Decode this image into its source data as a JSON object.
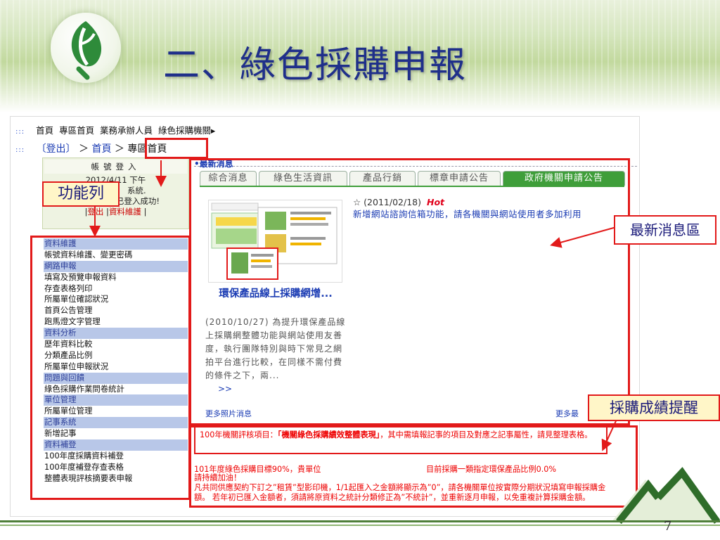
{
  "slide": {
    "title": "二、綠色採購申報",
    "page_number": "7"
  },
  "nav": {
    "primary": [
      "首頁",
      "專區首頁",
      "業務承辦人員",
      "綠色採購機關▸"
    ],
    "logout": "〔登出〕",
    "crumb_sep": "＞",
    "crumb_home": "首頁",
    "crumb_current": "專區首頁"
  },
  "login_box": {
    "header": "帳號登入",
    "date_fragment": "2012/4/11 下午",
    "system_fragment": "系統.",
    "success_fragment": "3:53  0  ...您已登入成功!",
    "logout_link": "登出",
    "account_link": "資料維護"
  },
  "menu": [
    {
      "type": "cat",
      "label": "資料維護"
    },
    {
      "type": "item",
      "label": "帳號資料維護、變更密碼"
    },
    {
      "type": "cat",
      "label": "網路申報"
    },
    {
      "type": "item",
      "label": "填寫及預覽申報資料"
    },
    {
      "type": "item",
      "label": "存查表格列印"
    },
    {
      "type": "item",
      "label": "所屬單位確認狀況"
    },
    {
      "type": "item",
      "label": "首頁公告管理"
    },
    {
      "type": "item",
      "label": "跑馬燈文字管理"
    },
    {
      "type": "cat",
      "label": "資料分析"
    },
    {
      "type": "item",
      "label": "歷年資料比較"
    },
    {
      "type": "item",
      "label": "分類產品比例"
    },
    {
      "type": "item",
      "label": "所屬單位申報狀況"
    },
    {
      "type": "cat",
      "label": "問題與回饋"
    },
    {
      "type": "item",
      "label": "綠色採購作業問卷統計"
    },
    {
      "type": "cat",
      "label": "單位管理"
    },
    {
      "type": "item",
      "label": "所屬單位管理"
    },
    {
      "type": "cat",
      "label": "記事系統"
    },
    {
      "type": "item",
      "label": "新增記事"
    },
    {
      "type": "cat",
      "label": "資料補登"
    },
    {
      "type": "item",
      "label": "100年度採購資料補登"
    },
    {
      "type": "item",
      "label": "100年度補登存查表格"
    },
    {
      "type": "item",
      "label": "整體表現評核摘要表申報"
    }
  ],
  "news": {
    "section_title": "•最新消息",
    "tabs": [
      "綜合消息",
      "綠色生活資訊",
      "產品行銷",
      "標章申請公告",
      "政府機關申請公告"
    ],
    "active_tab": 4,
    "photo_title": "環保產品線上採購網增...",
    "photo_desc": "(2010/10/27) 為提升環保產品線上採購網整體功能與網站使用友善度，執行團隊特別與時下常見之網拍平台進行比較，在同樣不需付費的條件之下，兩...",
    "photo_more": ">>",
    "more_photos": "更多照片消息",
    "more_news": "更多最",
    "item_date": "☆ (2011/02/18)",
    "item_hot": "Hot",
    "item_text": "新增網站諮詢信箱功能，請各機關與網站使用者多加利用"
  },
  "evaluation": {
    "text_a": "100年機關評核項目：",
    "text_b": "「機關綠色採購績效整體表現」",
    "text_c": "，其中需填報記事的項目及對應之記事屬性，請見整理表格。"
  },
  "goal": {
    "left": "101年度綠色採購目標90%，貴單位",
    "right": "目前採購一類指定環保產品比例0.0%",
    "line2": "請持續加油！",
    "line3": "凡共同供應契約下訂之”租賃”型影印機，1/1起匯入之金額將顯示為”0”，請各機關單位按實際分期狀況填寫申報採購金額。 若年初已匯入金額者，須請將原資料之統計分類修正為”不統計”，並重新逐月申報，以免重複計算採購金額。"
  },
  "callouts": {
    "function_bar": "功能列",
    "latest_news": "最新消息區",
    "procurement_reminder": "採購成績提醒"
  },
  "colors": {
    "title_blue": "#1f2f8a",
    "annotation_red": "#e21a1a",
    "tab_green": "#3f9e3a",
    "menu_category": "#b8c7e8",
    "callout_yellow": "#fff6c8"
  }
}
